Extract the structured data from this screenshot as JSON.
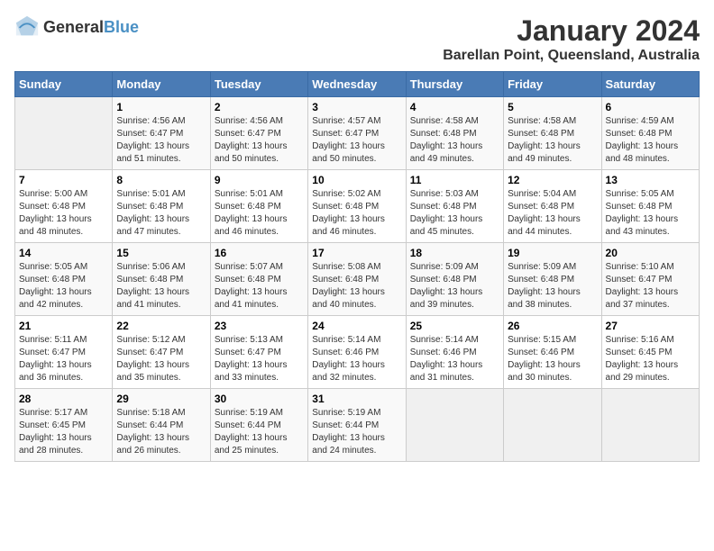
{
  "header": {
    "logo_general": "General",
    "logo_blue": "Blue",
    "title": "January 2024",
    "subtitle": "Barellan Point, Queensland, Australia"
  },
  "weekdays": [
    "Sunday",
    "Monday",
    "Tuesday",
    "Wednesday",
    "Thursday",
    "Friday",
    "Saturday"
  ],
  "weeks": [
    [
      {
        "day": "",
        "sunrise": "",
        "sunset": "",
        "daylight": ""
      },
      {
        "day": "1",
        "sunrise": "Sunrise: 4:56 AM",
        "sunset": "Sunset: 6:47 PM",
        "daylight": "Daylight: 13 hours and 51 minutes."
      },
      {
        "day": "2",
        "sunrise": "Sunrise: 4:56 AM",
        "sunset": "Sunset: 6:47 PM",
        "daylight": "Daylight: 13 hours and 50 minutes."
      },
      {
        "day": "3",
        "sunrise": "Sunrise: 4:57 AM",
        "sunset": "Sunset: 6:47 PM",
        "daylight": "Daylight: 13 hours and 50 minutes."
      },
      {
        "day": "4",
        "sunrise": "Sunrise: 4:58 AM",
        "sunset": "Sunset: 6:48 PM",
        "daylight": "Daylight: 13 hours and 49 minutes."
      },
      {
        "day": "5",
        "sunrise": "Sunrise: 4:58 AM",
        "sunset": "Sunset: 6:48 PM",
        "daylight": "Daylight: 13 hours and 49 minutes."
      },
      {
        "day": "6",
        "sunrise": "Sunrise: 4:59 AM",
        "sunset": "Sunset: 6:48 PM",
        "daylight": "Daylight: 13 hours and 48 minutes."
      }
    ],
    [
      {
        "day": "7",
        "sunrise": "Sunrise: 5:00 AM",
        "sunset": "Sunset: 6:48 PM",
        "daylight": "Daylight: 13 hours and 48 minutes."
      },
      {
        "day": "8",
        "sunrise": "Sunrise: 5:01 AM",
        "sunset": "Sunset: 6:48 PM",
        "daylight": "Daylight: 13 hours and 47 minutes."
      },
      {
        "day": "9",
        "sunrise": "Sunrise: 5:01 AM",
        "sunset": "Sunset: 6:48 PM",
        "daylight": "Daylight: 13 hours and 46 minutes."
      },
      {
        "day": "10",
        "sunrise": "Sunrise: 5:02 AM",
        "sunset": "Sunset: 6:48 PM",
        "daylight": "Daylight: 13 hours and 46 minutes."
      },
      {
        "day": "11",
        "sunrise": "Sunrise: 5:03 AM",
        "sunset": "Sunset: 6:48 PM",
        "daylight": "Daylight: 13 hours and 45 minutes."
      },
      {
        "day": "12",
        "sunrise": "Sunrise: 5:04 AM",
        "sunset": "Sunset: 6:48 PM",
        "daylight": "Daylight: 13 hours and 44 minutes."
      },
      {
        "day": "13",
        "sunrise": "Sunrise: 5:05 AM",
        "sunset": "Sunset: 6:48 PM",
        "daylight": "Daylight: 13 hours and 43 minutes."
      }
    ],
    [
      {
        "day": "14",
        "sunrise": "Sunrise: 5:05 AM",
        "sunset": "Sunset: 6:48 PM",
        "daylight": "Daylight: 13 hours and 42 minutes."
      },
      {
        "day": "15",
        "sunrise": "Sunrise: 5:06 AM",
        "sunset": "Sunset: 6:48 PM",
        "daylight": "Daylight: 13 hours and 41 minutes."
      },
      {
        "day": "16",
        "sunrise": "Sunrise: 5:07 AM",
        "sunset": "Sunset: 6:48 PM",
        "daylight": "Daylight: 13 hours and 41 minutes."
      },
      {
        "day": "17",
        "sunrise": "Sunrise: 5:08 AM",
        "sunset": "Sunset: 6:48 PM",
        "daylight": "Daylight: 13 hours and 40 minutes."
      },
      {
        "day": "18",
        "sunrise": "Sunrise: 5:09 AM",
        "sunset": "Sunset: 6:48 PM",
        "daylight": "Daylight: 13 hours and 39 minutes."
      },
      {
        "day": "19",
        "sunrise": "Sunrise: 5:09 AM",
        "sunset": "Sunset: 6:48 PM",
        "daylight": "Daylight: 13 hours and 38 minutes."
      },
      {
        "day": "20",
        "sunrise": "Sunrise: 5:10 AM",
        "sunset": "Sunset: 6:47 PM",
        "daylight": "Daylight: 13 hours and 37 minutes."
      }
    ],
    [
      {
        "day": "21",
        "sunrise": "Sunrise: 5:11 AM",
        "sunset": "Sunset: 6:47 PM",
        "daylight": "Daylight: 13 hours and 36 minutes."
      },
      {
        "day": "22",
        "sunrise": "Sunrise: 5:12 AM",
        "sunset": "Sunset: 6:47 PM",
        "daylight": "Daylight: 13 hours and 35 minutes."
      },
      {
        "day": "23",
        "sunrise": "Sunrise: 5:13 AM",
        "sunset": "Sunset: 6:47 PM",
        "daylight": "Daylight: 13 hours and 33 minutes."
      },
      {
        "day": "24",
        "sunrise": "Sunrise: 5:14 AM",
        "sunset": "Sunset: 6:46 PM",
        "daylight": "Daylight: 13 hours and 32 minutes."
      },
      {
        "day": "25",
        "sunrise": "Sunrise: 5:14 AM",
        "sunset": "Sunset: 6:46 PM",
        "daylight": "Daylight: 13 hours and 31 minutes."
      },
      {
        "day": "26",
        "sunrise": "Sunrise: 5:15 AM",
        "sunset": "Sunset: 6:46 PM",
        "daylight": "Daylight: 13 hours and 30 minutes."
      },
      {
        "day": "27",
        "sunrise": "Sunrise: 5:16 AM",
        "sunset": "Sunset: 6:45 PM",
        "daylight": "Daylight: 13 hours and 29 minutes."
      }
    ],
    [
      {
        "day": "28",
        "sunrise": "Sunrise: 5:17 AM",
        "sunset": "Sunset: 6:45 PM",
        "daylight": "Daylight: 13 hours and 28 minutes."
      },
      {
        "day": "29",
        "sunrise": "Sunrise: 5:18 AM",
        "sunset": "Sunset: 6:44 PM",
        "daylight": "Daylight: 13 hours and 26 minutes."
      },
      {
        "day": "30",
        "sunrise": "Sunrise: 5:19 AM",
        "sunset": "Sunset: 6:44 PM",
        "daylight": "Daylight: 13 hours and 25 minutes."
      },
      {
        "day": "31",
        "sunrise": "Sunrise: 5:19 AM",
        "sunset": "Sunset: 6:44 PM",
        "daylight": "Daylight: 13 hours and 24 minutes."
      },
      {
        "day": "",
        "sunrise": "",
        "sunset": "",
        "daylight": ""
      },
      {
        "day": "",
        "sunrise": "",
        "sunset": "",
        "daylight": ""
      },
      {
        "day": "",
        "sunrise": "",
        "sunset": "",
        "daylight": ""
      }
    ]
  ]
}
